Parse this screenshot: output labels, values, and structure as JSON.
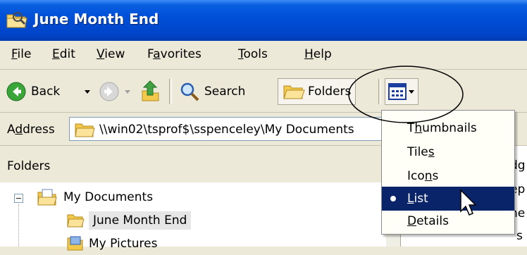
{
  "window": {
    "title": "June Month End"
  },
  "menubar": {
    "items": [
      {
        "pre": "",
        "key": "F",
        "post": "ile"
      },
      {
        "pre": "",
        "key": "E",
        "post": "dit"
      },
      {
        "pre": "",
        "key": "V",
        "post": "iew"
      },
      {
        "pre": "F",
        "key": "a",
        "post": "vorites"
      },
      {
        "pre": "",
        "key": "T",
        "post": "ools"
      },
      {
        "pre": "",
        "key": "H",
        "post": "elp"
      }
    ]
  },
  "toolbar": {
    "back_label": "Back",
    "search_label": "Search",
    "folders_label": "Folders"
  },
  "address": {
    "label_pre": "A",
    "label_key": "d",
    "label_post": "dress",
    "value": "\\\\win02\\tsprof$\\sspenceley\\My Documents"
  },
  "folders_pane": {
    "title": "Folders",
    "close": "×",
    "tree": [
      {
        "label": "My Documents",
        "expander": "−"
      },
      {
        "label": "June Month End"
      },
      {
        "label": "My Pictures"
      }
    ]
  },
  "right_pane_fragments": [
    "dg",
    "ep",
    "he",
    "s"
  ],
  "view_menu": {
    "items": [
      {
        "pre": "T",
        "key": "h",
        "post": "umbnails"
      },
      {
        "pre": "Tile",
        "key": "s",
        "post": ""
      },
      {
        "pre": "Ico",
        "key": "n",
        "post": "s"
      },
      {
        "pre": "",
        "key": "L",
        "post": "ist",
        "selected": true
      },
      {
        "pre": "",
        "key": "D",
        "post": "etails"
      }
    ]
  },
  "colors": {
    "titlebar_blue": "#0050d8",
    "menu_highlight": "#0a246a",
    "chrome": "#ece9d8"
  }
}
